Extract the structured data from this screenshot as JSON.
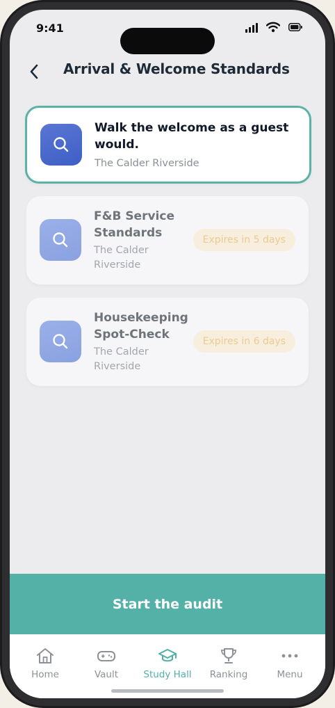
{
  "status_bar": {
    "time": "9:41"
  },
  "header": {
    "title": "Arrival & Welcome Standards"
  },
  "audits": [
    {
      "title_line1": "Walk the welcome as a guest",
      "title_line2": "would.",
      "subtitle_line1": "The Calder Riverside",
      "subtitle_line2": "",
      "badge": "",
      "icon": "search-icon",
      "selected": true
    },
    {
      "title_line1": "F&B Service",
      "title_line2": "Standards",
      "subtitle_line1": "The Calder",
      "subtitle_line2": "Riverside",
      "badge": "Expires in 5 days",
      "icon": "search-icon",
      "selected": false
    },
    {
      "title_line1": "Housekeeping",
      "title_line2": "Spot-Check",
      "subtitle_line1": "The Calder",
      "subtitle_line2": "Riverside",
      "badge": "Expires in 6 days",
      "icon": "search-icon",
      "selected": false
    }
  ],
  "cta": {
    "label": "Start the audit"
  },
  "tabs": [
    {
      "label": "Home",
      "icon": "home-icon",
      "active": false
    },
    {
      "label": "Vault",
      "icon": "gamepad-icon",
      "active": false
    },
    {
      "label": "Study Hall",
      "icon": "graduation-cap-icon",
      "active": true
    },
    {
      "label": "Ranking",
      "icon": "trophy-icon",
      "active": false
    },
    {
      "label": "Menu",
      "icon": "more-icon",
      "active": false
    }
  ],
  "colors": {
    "accent": "#53b1a8",
    "icon_tile": "#4a68cc",
    "badge_bg": "#f7eedd",
    "badge_text": "#ebcb93"
  }
}
